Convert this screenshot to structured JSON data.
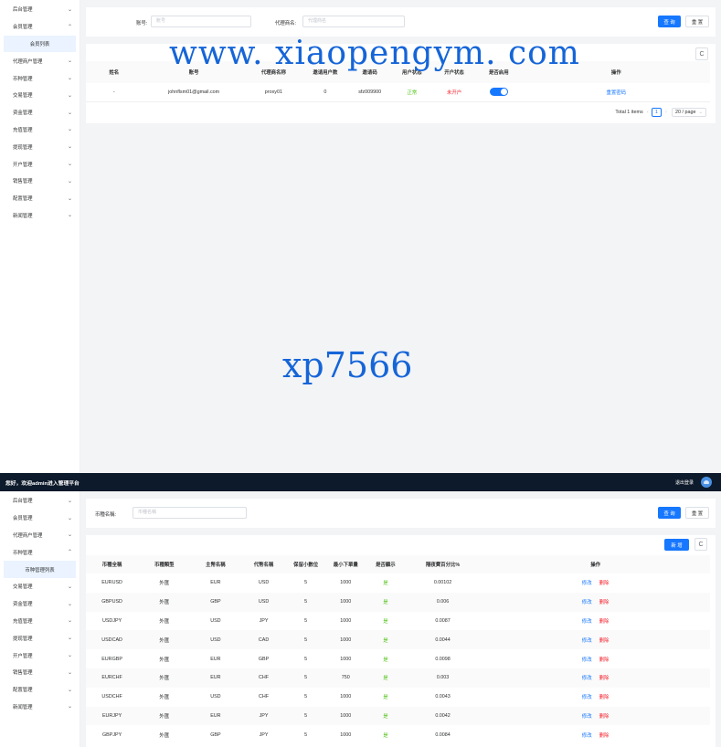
{
  "panel1": {
    "sidebar": [
      {
        "label": "后台管理",
        "chevron": "⌄"
      },
      {
        "label": "会员管理",
        "chevron": "⌃"
      },
      {
        "label": "会员列表",
        "sub": true
      },
      {
        "label": "代理商户管理",
        "chevron": "⌄"
      },
      {
        "label": "币种管理",
        "chevron": "⌄"
      },
      {
        "label": "交易管理",
        "chevron": "⌄"
      },
      {
        "label": "资金管理",
        "chevron": "⌄"
      },
      {
        "label": "充值管理",
        "chevron": "⌄"
      },
      {
        "label": "提现管理",
        "chevron": "⌄"
      },
      {
        "label": "开户管理",
        "chevron": "⌄"
      },
      {
        "label": "销售管理",
        "chevron": "⌄"
      },
      {
        "label": "配置管理",
        "chevron": "⌄"
      },
      {
        "label": "新闻管理",
        "chevron": "⌄"
      }
    ],
    "search": {
      "account_label": "账号:",
      "account_placeholder": "账号",
      "agent_label": "代理商名:",
      "agent_placeholder": "代理商名",
      "query_button": "查 询",
      "reset_button": "重 置"
    },
    "refresh_icon": "C",
    "table": {
      "headers": [
        "姓名",
        "账号",
        "代理商名称",
        "邀请用户数",
        "邀请码",
        "用户状态",
        "开户状态",
        "是否启用",
        "操作"
      ],
      "rows": [
        {
          "name": "-",
          "account": "johnflsm01@gmail.com",
          "agent": "proxy01",
          "invited": "0",
          "code": "sfz009900",
          "user_status": "正常",
          "account_status": "未开户",
          "enabled": true,
          "action": "重置密码"
        }
      ]
    },
    "pagination": {
      "total": "Total 1 items",
      "prev": "‹",
      "page": "1",
      "next": "›",
      "page_size": "20 / page",
      "dropdown": "⌄"
    }
  },
  "watermarks": {
    "url": "www. xiaopengym. com",
    "code": "xp7566"
  },
  "topbar": {
    "welcome": "您好，欢迎admin进入管理平台",
    "logout": "退出登录"
  },
  "panel2": {
    "sidebar": [
      {
        "label": "后台管理",
        "chevron": "⌄"
      },
      {
        "label": "会员管理",
        "chevron": "⌄"
      },
      {
        "label": "代理商户管理",
        "chevron": "⌄"
      },
      {
        "label": "币种管理",
        "chevron": "⌃"
      },
      {
        "label": "币种管理列表",
        "sub": true
      },
      {
        "label": "交易管理",
        "chevron": "⌄"
      },
      {
        "label": "资金管理",
        "chevron": "⌄"
      },
      {
        "label": "充值管理",
        "chevron": "⌄"
      },
      {
        "label": "提现管理",
        "chevron": "⌄"
      },
      {
        "label": "开户管理",
        "chevron": "⌄"
      },
      {
        "label": "销售管理",
        "chevron": "⌄"
      },
      {
        "label": "配置管理",
        "chevron": "⌄"
      },
      {
        "label": "新闻管理",
        "chevron": "⌄"
      }
    ],
    "search": {
      "currency_label": "币種名稱:",
      "currency_placeholder": "币種名稱",
      "query_button": "查 询",
      "reset_button": "重 置"
    },
    "add_button": "新 增",
    "refresh_icon": "C",
    "table": {
      "headers": [
        "币種全稱",
        "币種類型",
        "主幣名稱",
        "代幣名稱",
        "保留小數位",
        "最小下單量",
        "是否顯示",
        "隔夜費百分比%",
        "操作"
      ],
      "edit_label": "修改",
      "delete_label": "删除",
      "rows": [
        [
          "EURUSD",
          "外匯",
          "EUR",
          "USD",
          "5",
          "1000",
          "是",
          "0.00102"
        ],
        [
          "GBPUSD",
          "外匯",
          "GBP",
          "USD",
          "5",
          "1000",
          "是",
          "0.006"
        ],
        [
          "USDJPY",
          "外匯",
          "USD",
          "JPY",
          "5",
          "1000",
          "是",
          "0.0087"
        ],
        [
          "USDCAD",
          "外匯",
          "USD",
          "CAD",
          "5",
          "1000",
          "是",
          "0.0044"
        ],
        [
          "EURGBP",
          "外匯",
          "EUR",
          "GBP",
          "5",
          "1000",
          "是",
          "0.0098"
        ],
        [
          "EURCHF",
          "外匯",
          "EUR",
          "CHF",
          "5",
          "750",
          "是",
          "0.003"
        ],
        [
          "USDCHF",
          "外匯",
          "USD",
          "CHF",
          "5",
          "1000",
          "是",
          "0.0043"
        ],
        [
          "EURJPY",
          "外匯",
          "EUR",
          "JPY",
          "5",
          "1000",
          "是",
          "0.0042"
        ],
        [
          "GBPJPY",
          "外匯",
          "GBP",
          "JPY",
          "5",
          "1000",
          "是",
          "0.0084"
        ]
      ]
    }
  },
  "colors": {
    "primary": "#1677ff",
    "success": "#52c41a",
    "danger": "#f5222d",
    "topbar": "#0d1a2b",
    "watermark": "#1565d8"
  }
}
